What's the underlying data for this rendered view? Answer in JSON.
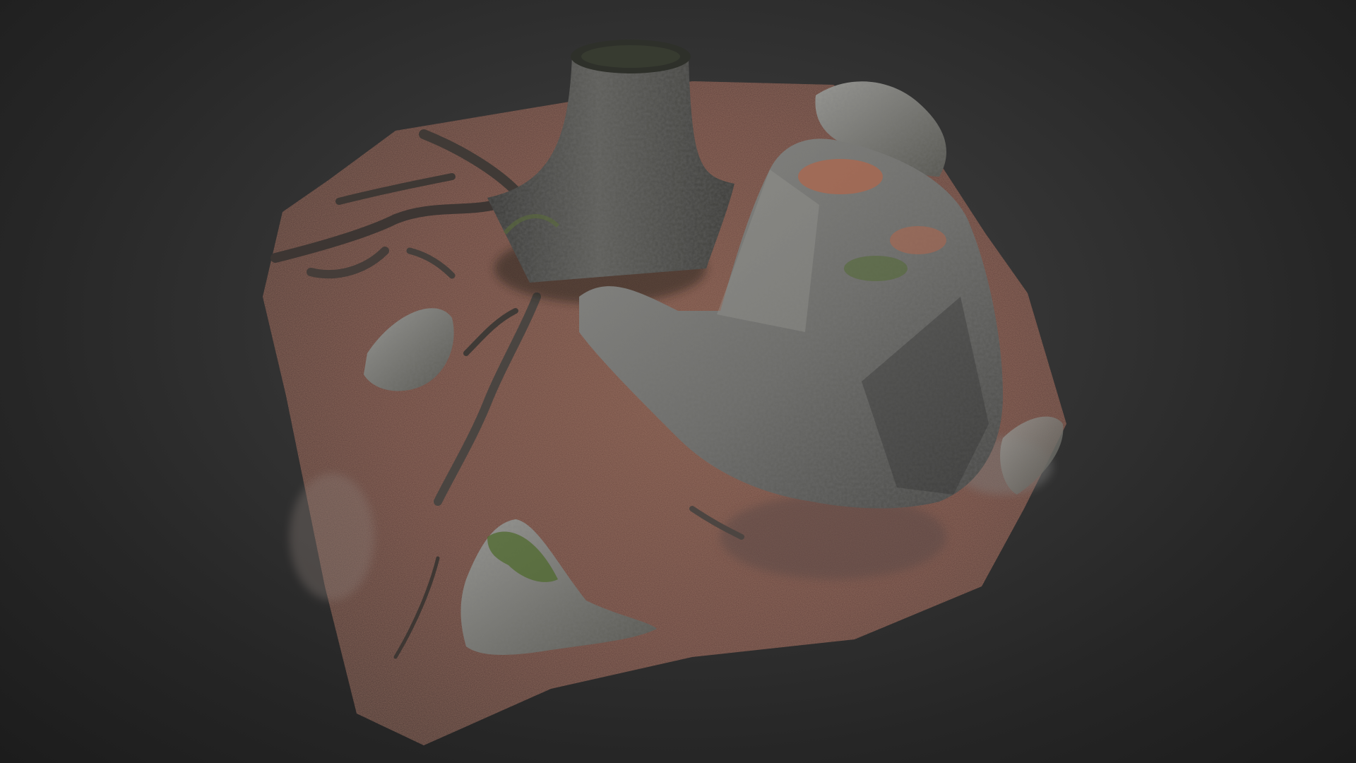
{
  "viewer": {
    "background_top": "#414141",
    "background_edge": "#1c1c1c"
  },
  "scene": {
    "subject": "photogrammetry-forest-floor-tile",
    "objects": [
      {
        "name": "tree-stump",
        "icon": "stump-icon"
      },
      {
        "name": "large-boulder",
        "icon": "rock-icon"
      },
      {
        "name": "back-rock",
        "icon": "rock-icon"
      },
      {
        "name": "mossy-front-rock",
        "icon": "rock-icon"
      },
      {
        "name": "left-small-rock",
        "icon": "rock-icon"
      },
      {
        "name": "exposed-roots",
        "icon": "root-icon"
      }
    ],
    "colors": {
      "ground_base": "#6b4a40",
      "leaf_litter": "#b0654a",
      "rock": "#7d7d7b",
      "rock_dark": "#4a4a48",
      "bark": "#4d4d4a",
      "moss": "#4f6a2e"
    }
  }
}
